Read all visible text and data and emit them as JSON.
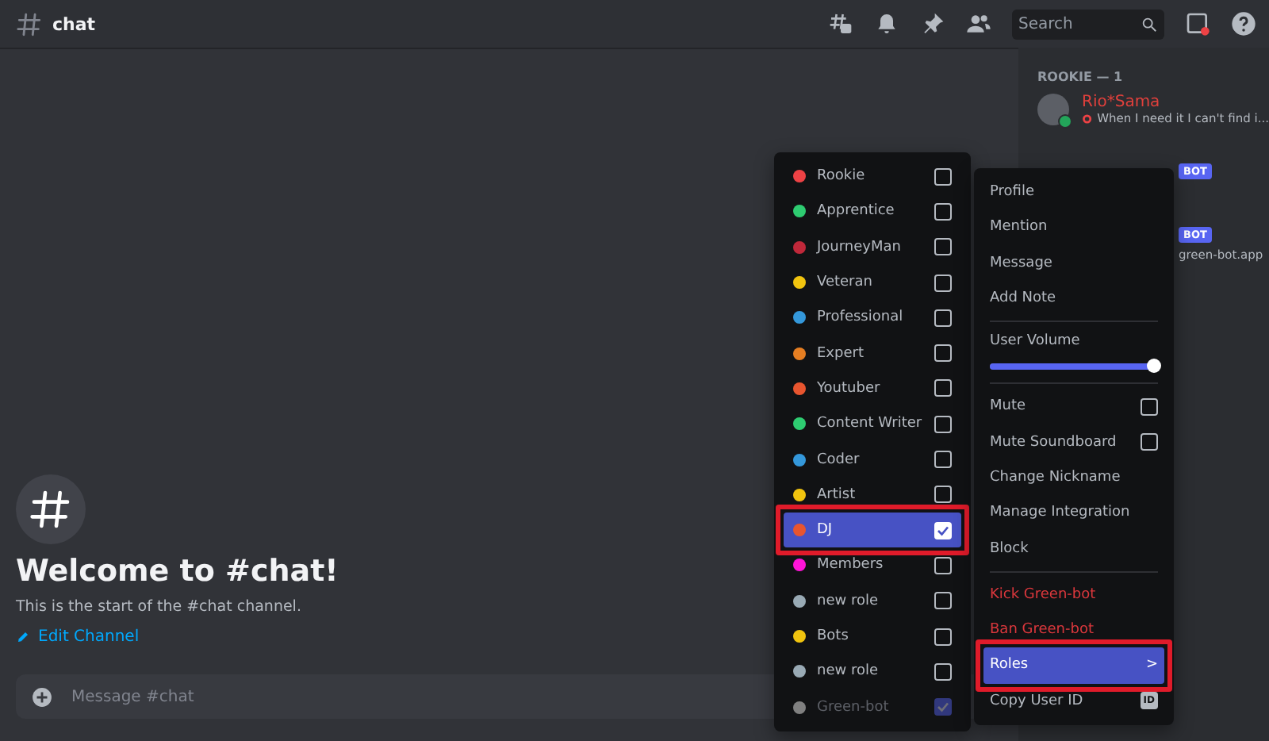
{
  "header": {
    "channel": "chat",
    "search": {
      "placeholder": "Search"
    }
  },
  "welcome": {
    "title": "Welcome to #chat!",
    "subtitle": "This is the start of the #chat channel.",
    "edit_link": "Edit Channel"
  },
  "composer": {
    "placeholder": "Message #chat"
  },
  "member_list": {
    "group": "ROOKIE — 1",
    "members": [
      {
        "name": "Rio*Sama",
        "status_text": "When I need it I can't find i...",
        "online": true,
        "color": "#e0403c"
      }
    ],
    "bot_badges": [
      "BOT",
      "BOT"
    ],
    "bot_status": "green-bot.app"
  },
  "role_menu": {
    "items": [
      {
        "label": "Rookie",
        "color": "#ed4245",
        "checked": false,
        "selected": false,
        "disabled": false,
        "highlighted": false
      },
      {
        "label": "Apprentice",
        "color": "#2ecc71",
        "checked": false,
        "selected": false,
        "disabled": false,
        "highlighted": false
      },
      {
        "label": "JourneyMan",
        "color": "#c0283a",
        "checked": false,
        "selected": false,
        "disabled": false,
        "highlighted": false
      },
      {
        "label": "Veteran",
        "color": "#f1c40f",
        "checked": false,
        "selected": false,
        "disabled": false,
        "highlighted": false
      },
      {
        "label": "Professional",
        "color": "#3498db",
        "checked": false,
        "selected": false,
        "disabled": false,
        "highlighted": false
      },
      {
        "label": "Expert",
        "color": "#e67e22",
        "checked": false,
        "selected": false,
        "disabled": false,
        "highlighted": false
      },
      {
        "label": "Youtuber",
        "color": "#e8552f",
        "checked": false,
        "selected": false,
        "disabled": false,
        "highlighted": false
      },
      {
        "label": "Content Writer",
        "color": "#2ecc71",
        "checked": false,
        "selected": false,
        "disabled": false,
        "highlighted": false
      },
      {
        "label": "Coder",
        "color": "#3498db",
        "checked": false,
        "selected": false,
        "disabled": false,
        "highlighted": false
      },
      {
        "label": "Artist",
        "color": "#f1c40f",
        "checked": false,
        "selected": false,
        "disabled": false,
        "highlighted": false
      },
      {
        "label": "DJ",
        "color": "#e8552f",
        "checked": true,
        "selected": true,
        "disabled": false,
        "highlighted": true
      },
      {
        "label": "Members",
        "color": "#ff14d8",
        "checked": false,
        "selected": false,
        "disabled": false,
        "highlighted": false
      },
      {
        "label": "new role",
        "color": "#99aab5",
        "checked": false,
        "selected": false,
        "disabled": false,
        "highlighted": false
      },
      {
        "label": "Bots",
        "color": "#f1c40f",
        "checked": false,
        "selected": false,
        "disabled": false,
        "highlighted": false
      },
      {
        "label": "new role",
        "color": "#99aab5",
        "checked": false,
        "selected": false,
        "disabled": false,
        "highlighted": false
      },
      {
        "label": "Green-bot",
        "color": "#808080",
        "checked": true,
        "selected": false,
        "disabled": true,
        "highlighted": false
      }
    ]
  },
  "context_menu": {
    "items": [
      {
        "kind": "item",
        "label": "Profile"
      },
      {
        "kind": "item",
        "label": "Mention"
      },
      {
        "kind": "item",
        "label": "Message"
      },
      {
        "kind": "item",
        "label": "Add Note"
      },
      {
        "kind": "separator"
      },
      {
        "kind": "slider",
        "label": "User Volume",
        "level": 1
      },
      {
        "kind": "separator"
      },
      {
        "kind": "checkbox",
        "label": "Mute",
        "checked": false
      },
      {
        "kind": "checkbox",
        "label": "Mute Soundboard",
        "checked": false
      },
      {
        "kind": "item",
        "label": "Change Nickname"
      },
      {
        "kind": "item",
        "label": "Manage Integration"
      },
      {
        "kind": "item",
        "label": "Block"
      },
      {
        "kind": "separator"
      },
      {
        "kind": "danger",
        "label": "Kick Green-bot"
      },
      {
        "kind": "danger",
        "label": "Ban Green-bot"
      },
      {
        "kind": "submenu",
        "label": "Roles",
        "arrow": ">",
        "selected": true,
        "highlighted": true
      },
      {
        "kind": "id",
        "label": "Copy User ID",
        "badge": "ID"
      }
    ]
  }
}
